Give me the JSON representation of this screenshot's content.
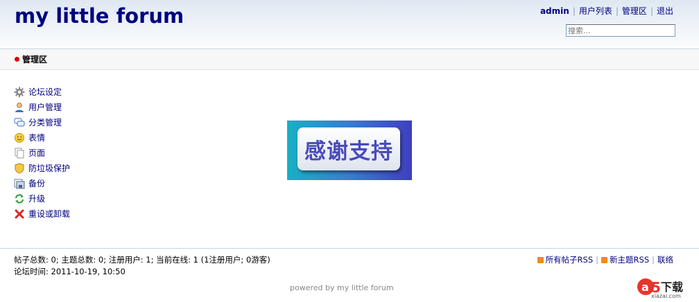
{
  "header": {
    "logo": "my little forum",
    "user_nav": {
      "username": "admin",
      "user_list": "用户列表",
      "admin_area": "管理区",
      "logout": "退出"
    },
    "search": {
      "placeholder": "搜索..."
    }
  },
  "subnav": {
    "title": "管理区"
  },
  "admin_menu": [
    {
      "label": "论坛设定",
      "icon": "gear-icon"
    },
    {
      "label": "用户管理",
      "icon": "user-icon"
    },
    {
      "label": "分类管理",
      "icon": "categories-icon"
    },
    {
      "label": "表情",
      "icon": "smiley-icon"
    },
    {
      "label": "页面",
      "icon": "pages-icon"
    },
    {
      "label": "防垃圾保护",
      "icon": "shield-icon"
    },
    {
      "label": "备份",
      "icon": "backup-icon"
    },
    {
      "label": "升级",
      "icon": "update-icon"
    },
    {
      "label": "重设或卸载",
      "icon": "delete-icon"
    }
  ],
  "banner": {
    "text": "感谢支持"
  },
  "footer": {
    "stats": "帖子总数: 0; 主题总数: 0; 注册用户: 1; 当前在线: 1 (1注册用户; 0游客)",
    "forum_time": "论坛时间: 2011-10-19, 10:50",
    "rss_all": "所有帖子RSS",
    "rss_new": "新主题RSS",
    "contact": "联络",
    "powered_by": "powered by my little forum"
  },
  "watermark": {
    "text": "下载",
    "domain": "xiazai.com"
  },
  "colors": {
    "link": "#000080",
    "rss": "#f08a24",
    "bullet": "#e00000"
  }
}
